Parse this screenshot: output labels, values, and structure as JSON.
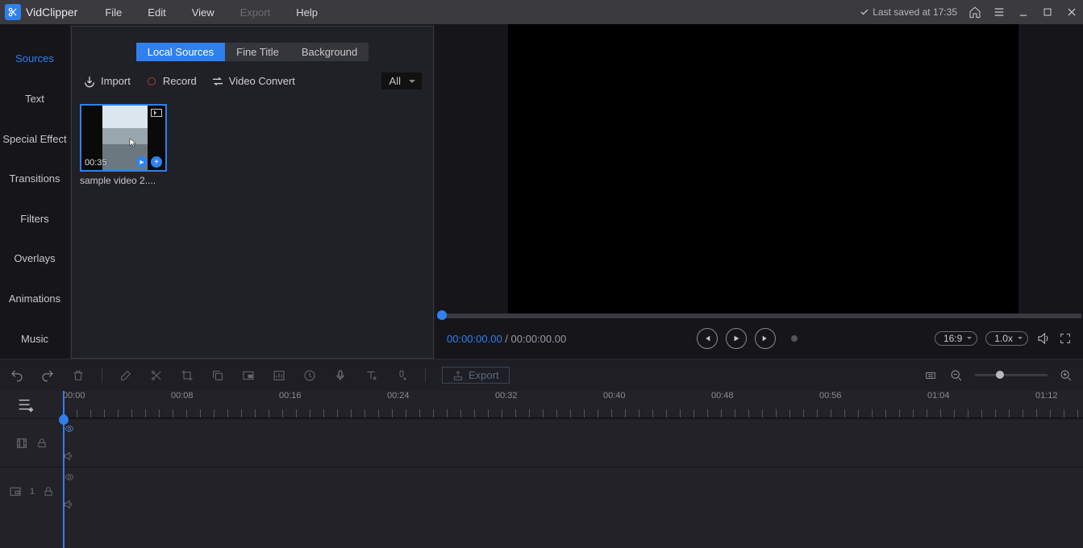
{
  "app": {
    "name": "VidClipper"
  },
  "menus": {
    "file": "File",
    "edit": "Edit",
    "view": "View",
    "export": "Export",
    "help": "Help"
  },
  "status": {
    "saved": "Last saved at 17:35"
  },
  "sidebar": {
    "items": [
      {
        "label": "Sources"
      },
      {
        "label": "Text"
      },
      {
        "label": "Special Effect"
      },
      {
        "label": "Transitions"
      },
      {
        "label": "Filters"
      },
      {
        "label": "Overlays"
      },
      {
        "label": "Animations"
      },
      {
        "label": "Music"
      }
    ]
  },
  "panel": {
    "tabs": {
      "local": "Local Sources",
      "title": "Fine Title",
      "bg": "Background"
    },
    "tools": {
      "import": "Import",
      "record": "Record",
      "convert": "Video Convert"
    },
    "filter": {
      "selected": "All"
    }
  },
  "thumbs": [
    {
      "duration": "00:35",
      "name": "sample video 2...."
    }
  ],
  "preview": {
    "time_current": "00:00:00.00",
    "time_sep": " / ",
    "time_total": "00:00:00.00",
    "ratio": "16:9",
    "speed": "1.0x"
  },
  "toolbar": {
    "export": "Export"
  },
  "ruler": [
    "00:00",
    "00:08",
    "00:16",
    "00:24",
    "00:32",
    "00:40",
    "00:48",
    "00:56",
    "01:04",
    "01:12"
  ],
  "track2_index": "1"
}
